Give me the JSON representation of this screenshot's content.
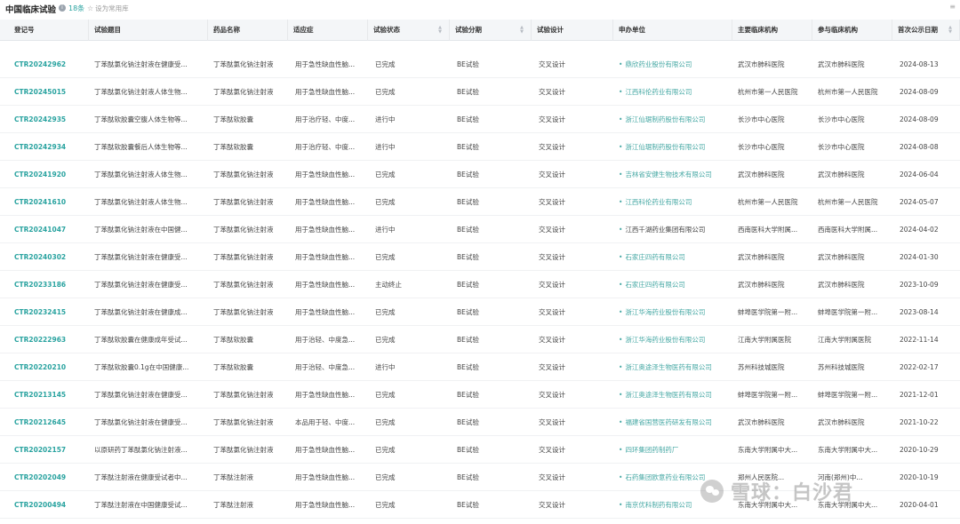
{
  "topbar": {
    "title": "中国临床试验",
    "count": "18条",
    "favorite": "设为常用库",
    "more": "≡"
  },
  "columns": [
    {
      "label": "登记号",
      "sortable": false
    },
    {
      "label": "试验题目",
      "sortable": false
    },
    {
      "label": "药品名称",
      "sortable": false
    },
    {
      "label": "适应症",
      "sortable": false
    },
    {
      "label": "试验状态",
      "sortable": true
    },
    {
      "label": "试验分期",
      "sortable": true
    },
    {
      "label": "试验设计",
      "sortable": false
    },
    {
      "label": "申办单位",
      "sortable": false
    },
    {
      "label": "主要临床机构",
      "sortable": false
    },
    {
      "label": "参与临床机构",
      "sortable": false
    },
    {
      "label": "首次公示日期",
      "sortable": true
    }
  ],
  "rows": [
    {
      "reg": "CTR20242962",
      "title": "丁苯酞氯化钠注射液在健康受...",
      "drug": "丁苯酞氯化钠注射液",
      "indication": "用于急性缺血性脑...",
      "status": "已完成",
      "phase": "BE试验",
      "design": "交叉设计",
      "sponsor": "鼎欣药业股份有限公司",
      "sponsor_link": true,
      "main_site": "武汉市肺科医院",
      "other_site": "武汉市肺科医院",
      "date": "2024-08-13"
    },
    {
      "reg": "CTR20245015",
      "title": "丁苯酞氯化钠注射液人体生物...",
      "drug": "丁苯酞氯化钠注射液",
      "indication": "用于急性缺血性脑...",
      "status": "已完成",
      "phase": "BE试验",
      "design": "交叉设计",
      "sponsor": "江西科伦药业有限公司",
      "sponsor_link": true,
      "main_site": "杭州市第一人民医院",
      "other_site": "杭州市第一人民医院",
      "date": "2024-08-09"
    },
    {
      "reg": "CTR20242935",
      "title": "丁苯酞软胶囊空腹人体生物等...",
      "drug": "丁苯酞软胶囊",
      "indication": "用于治疗轻、中度...",
      "status": "进行中",
      "phase": "BE试验",
      "design": "交叉设计",
      "sponsor": "浙江仙琚制药股份有限公司",
      "sponsor_link": true,
      "main_site": "长沙市中心医院",
      "other_site": "长沙市中心医院",
      "date": "2024-08-09"
    },
    {
      "reg": "CTR20242934",
      "title": "丁苯酞软胶囊餐后人体生物等...",
      "drug": "丁苯酞软胶囊",
      "indication": "用于治疗轻、中度...",
      "status": "进行中",
      "phase": "BE试验",
      "design": "交叉设计",
      "sponsor": "浙江仙琚制药股份有限公司",
      "sponsor_link": true,
      "main_site": "长沙市中心医院",
      "other_site": "长沙市中心医院",
      "date": "2024-08-08"
    },
    {
      "reg": "CTR20241920",
      "title": "丁苯酞氯化钠注射液人体生物...",
      "drug": "丁苯酞氯化钠注射液",
      "indication": "用于急性缺血性脑...",
      "status": "已完成",
      "phase": "BE试验",
      "design": "交叉设计",
      "sponsor": "吉林省安健生物技术有限公司",
      "sponsor_link": true,
      "main_site": "武汉市肺科医院",
      "other_site": "武汉市肺科医院",
      "date": "2024-06-04"
    },
    {
      "reg": "CTR20241610",
      "title": "丁苯酞氯化钠注射液人体生物...",
      "drug": "丁苯酞氯化钠注射液",
      "indication": "用于急性缺血性脑...",
      "status": "已完成",
      "phase": "BE试验",
      "design": "交叉设计",
      "sponsor": "江西科伦药业有限公司",
      "sponsor_link": true,
      "main_site": "杭州市第一人民医院",
      "other_site": "杭州市第一人民医院",
      "date": "2024-05-07"
    },
    {
      "reg": "CTR20241047",
      "title": "丁苯酞氯化钠注射液在中国健...",
      "drug": "丁苯酞氯化钠注射液",
      "indication": "用于急性缺血性脑...",
      "status": "进行中",
      "phase": "BE试验",
      "design": "交叉设计",
      "sponsor": "江西千湖药业集团有限公司",
      "sponsor_link": false,
      "main_site": "西南医科大学附属...",
      "other_site": "西南医科大学附属...",
      "date": "2024-04-02"
    },
    {
      "reg": "CTR20240302",
      "title": "丁苯酞氯化钠注射液在健康受...",
      "drug": "丁苯酞氯化钠注射液",
      "indication": "用于急性缺血性脑...",
      "status": "已完成",
      "phase": "BE试验",
      "design": "交叉设计",
      "sponsor": "石家庄四药有限公司",
      "sponsor_link": true,
      "main_site": "武汉市肺科医院",
      "other_site": "武汉市肺科医院",
      "date": "2024-01-30"
    },
    {
      "reg": "CTR20233186",
      "title": "丁苯酞氯化钠注射液在健康受...",
      "drug": "丁苯酞氯化钠注射液",
      "indication": "用于急性缺血性脑...",
      "status": "主动终止",
      "phase": "BE试验",
      "design": "交叉设计",
      "sponsor": "石家庄四药有限公司",
      "sponsor_link": true,
      "main_site": "武汉市肺科医院",
      "other_site": "武汉市肺科医院",
      "date": "2023-10-09"
    },
    {
      "reg": "CTR20232415",
      "title": "丁苯酞氯化钠注射液在健康成...",
      "drug": "丁苯酞氯化钠注射液",
      "indication": "用于急性缺血性脑...",
      "status": "已完成",
      "phase": "BE试验",
      "design": "交叉设计",
      "sponsor": "浙江华海药业股份有限公司",
      "sponsor_link": true,
      "main_site": "蚌埠医学院第一附...",
      "other_site": "蚌埠医学院第一附...",
      "date": "2023-08-14"
    },
    {
      "reg": "CTR20222963",
      "title": "丁苯酞软胶囊在健康成年受试...",
      "drug": "丁苯酞软胶囊",
      "indication": "用于治轻、中度急...",
      "status": "已完成",
      "phase": "BE试验",
      "design": "交叉设计",
      "sponsor": "浙江华海药业股份有限公司",
      "sponsor_link": true,
      "main_site": "江南大学附属医院",
      "other_site": "江南大学附属医院",
      "date": "2022-11-14"
    },
    {
      "reg": "CTR20220210",
      "title": "丁苯酞软胶囊0.1g在中国健康...",
      "drug": "丁苯酞软胶囊",
      "indication": "用于治轻、中度急...",
      "status": "进行中",
      "phase": "BE试验",
      "design": "交叉设计",
      "sponsor": "浙江奥途泽生物医药有限公司",
      "sponsor_link": true,
      "main_site": "苏州科技城医院",
      "other_site": "苏州科技城医院",
      "date": "2022-02-17"
    },
    {
      "reg": "CTR20213145",
      "title": "丁苯酞氯化钠注射液在健康受...",
      "drug": "丁苯酞氯化钠注射液",
      "indication": "用于急性缺血性脑...",
      "status": "已完成",
      "phase": "BE试验",
      "design": "交叉设计",
      "sponsor": "浙江奥途泽生物医药有限公司",
      "sponsor_link": true,
      "main_site": "蚌埠医学院第一附...",
      "other_site": "蚌埠医学院第一附...",
      "date": "2021-12-01"
    },
    {
      "reg": "CTR20212645",
      "title": "丁苯酞氯化钠注射液在健康受...",
      "drug": "丁苯酞氯化钠注射液",
      "indication": "本品用于轻、中度...",
      "status": "已完成",
      "phase": "BE试验",
      "design": "交叉设计",
      "sponsor": "福建省国营医药研发有限公司",
      "sponsor_link": true,
      "main_site": "武汉市肺科医院",
      "other_site": "武汉市肺科医院",
      "date": "2021-10-22"
    },
    {
      "reg": "CTR20202157",
      "title": "以原研药丁苯酞氯化钠注射液...",
      "drug": "丁苯酞氯化钠注射液",
      "indication": "用于急性缺血性脑...",
      "status": "已完成",
      "phase": "BE试验",
      "design": "交叉设计",
      "sponsor": "四环集团药制药厂",
      "sponsor_link": true,
      "main_site": "东南大学附属中大...",
      "other_site": "东南大学附属中大...",
      "date": "2020-10-29"
    },
    {
      "reg": "CTR20202049",
      "title": "丁苯酞注射液在健康受试者中...",
      "drug": "丁苯酞注射液",
      "indication": "用于急性缺血性脑...",
      "status": "已完成",
      "phase": "BE试验",
      "design": "交叉设计",
      "sponsor": "石药集团欧意药业有限公司",
      "sponsor_link": true,
      "main_site": "郑州人民医院...",
      "other_site": "河南(郑州)中...",
      "date": "2020-10-19"
    },
    {
      "reg": "CTR20200494",
      "title": "丁苯酞注射液在中国健康受试...",
      "drug": "丁苯酞注射液",
      "indication": "用于急性缺血性脑...",
      "status": "已完成",
      "phase": "BE试验",
      "design": "交叉设计",
      "sponsor": "南京优科制药有限公司",
      "sponsor_link": true,
      "main_site": "东南大学附属中大...",
      "other_site": "东南大学附属中大...",
      "date": "2020-04-01"
    }
  ],
  "watermark": {
    "text": "雪球：白沙君",
    "icon": "wechat-icon"
  }
}
